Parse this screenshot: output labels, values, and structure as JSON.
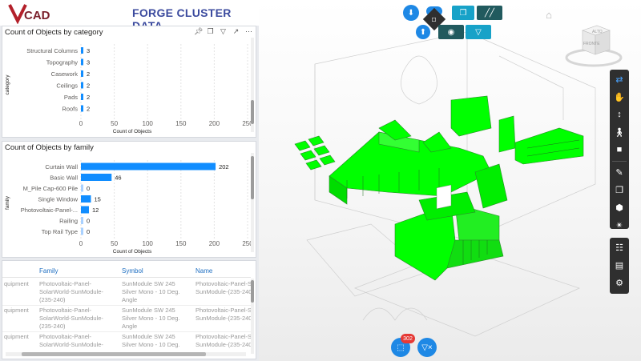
{
  "app": {
    "logo_text": "VCAD",
    "title": "FORGE CLUSTER DATA"
  },
  "chart_data": [
    {
      "type": "bar",
      "title": "Count of Objects by category",
      "ylabel": "category",
      "xlabel": "Count of Objects",
      "orientation": "horizontal",
      "categories": [
        "Structural Columns",
        "Topography",
        "Casework",
        "Ceilings",
        "Pads",
        "Roofs"
      ],
      "values": [
        3,
        3,
        2,
        2,
        2,
        2
      ],
      "xlim": [
        0,
        250
      ],
      "xticks": [
        "0",
        "50",
        "100",
        "150",
        "200",
        "250"
      ],
      "color": "#118dff",
      "grid": true
    },
    {
      "type": "bar",
      "title": "Count of Objects by family",
      "ylabel": "family",
      "xlabel": "Count of Objects",
      "orientation": "horizontal",
      "categories": [
        "Curtain Wall",
        "Basic Wall",
        "M_Pile Cap-600 Pile",
        "Single Window",
        "Photovoltaic-Panel-...",
        "Railing",
        "Top Rail Type"
      ],
      "values": [
        202,
        46,
        0,
        15,
        12,
        0,
        0
      ],
      "xlim": [
        0,
        250
      ],
      "xticks": [
        "0",
        "50",
        "100",
        "150",
        "200",
        "250"
      ],
      "color": "#118dff",
      "color_light": "#a9d1ff",
      "grid": true
    }
  ],
  "table": {
    "columns": [
      "Family",
      "Symbol",
      "Name"
    ],
    "first_col_partial": "quipment",
    "rows": [
      {
        "cat": "quipment",
        "family": [
          "Photovoltaic-Panel-",
          "SolarWorld-SunModule-",
          "(235-240)"
        ],
        "symbol": [
          "SunModule SW 245",
          "Silver Mono - 10 Deg.",
          "Angle"
        ],
        "name": [
          "Photovoltaic-Panel-S",
          "SunModule-(235-240"
        ]
      },
      {
        "cat": "quipment",
        "family": [
          "Photovoltaic-Panel-",
          "SolarWorld-SunModule-",
          "(235-240)"
        ],
        "symbol": [
          "SunModule SW 245",
          "Silver Mono - 10 Deg.",
          "Angle"
        ],
        "name": [
          "Photovoltaic-Panel-S",
          "SunModule-(235-240"
        ]
      },
      {
        "cat": "quipment",
        "family": [
          "Photovoltaic-Panel-",
          "SolarWorld-SunModule-"
        ],
        "symbol": [
          "SunModule SW 245",
          "Silver Mono - 10 Deg."
        ],
        "name": [
          "Photovoltaic-Panel-S",
          "SunModule-(235-240"
        ]
      }
    ]
  },
  "viewer": {
    "viewcube_top": "ALTO",
    "viewcube_front": "FRONTE",
    "selection_count": "302",
    "model_color": "#00ff00",
    "toolbar_icons": [
      "orbit-icon",
      "pan-icon",
      "fit-icon",
      "first-person-icon",
      "camera-icon",
      "measure-icon",
      "section-icon",
      "model-browser-icon",
      "explode-icon",
      "structure-icon",
      "properties-icon",
      "settings-icon"
    ],
    "top_buttons": [
      "download-icon",
      "upload-icon",
      "fit-to-view-icon",
      "focus-icon",
      "select-icon",
      "hatch-icon",
      "target-icon",
      "filter-icon"
    ]
  }
}
